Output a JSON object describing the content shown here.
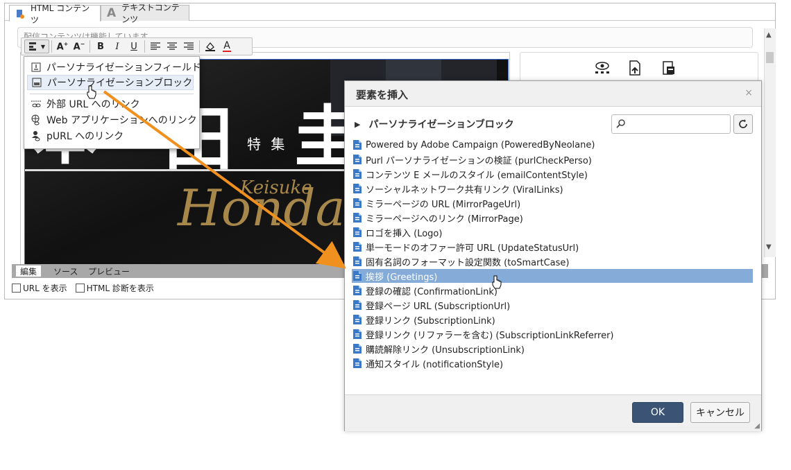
{
  "tabs": {
    "html": "HTML コンテンツ",
    "text": "テキストコンテンツ"
  },
  "editor": {
    "status_text": "配信コンテンツは機能しています",
    "bottom_tabs": [
      "編集",
      "ソース",
      "プレビュー"
    ],
    "checkboxes": [
      "URL を表示",
      "HTML 診断を表示"
    ]
  },
  "banner": {
    "kanji_left": "本",
    "kanji_mid": "田",
    "kanji_right": "圭",
    "tokushu": "特 集",
    "name_small": "Keisuke",
    "name_large": "Honda"
  },
  "menu": {
    "items": [
      {
        "label": "パーソナライゼーションフィールド",
        "icon": "field-icon"
      },
      {
        "label": "パーソナライゼーションブロック",
        "icon": "block-icon"
      },
      {
        "label": "外部 URL へのリンク",
        "icon": "link-icon"
      },
      {
        "label": "Web アプリケーションへのリンク",
        "icon": "web-link-icon"
      },
      {
        "label": "pURL へのリンク",
        "icon": "purl-icon"
      }
    ]
  },
  "dialog": {
    "title": "要素を挿入",
    "close": "×",
    "tree_label": "パーソナライゼーションブロック",
    "items": [
      "Powered by Adobe Campaign (PoweredByNeolane)",
      "Purl パーソナライゼーションの検証 (purlCheckPerso)",
      "コンテンツ E メールのスタイル (emailContentStyle)",
      "ソーシャルネットワーク共有リンク (ViralLinks)",
      "ミラーページの URL (MirrorPageUrl)",
      "ミラーページへのリンク (MirrorPage)",
      "ロゴを挿入 (Logo)",
      "単一モードのオファー許可 URL (UpdateStatusUrl)",
      "固有名詞のフォーマット設定関数 (toSmartCase)",
      "挨拶 (Greetings)",
      "登録の確認 (ConfirmationLink)",
      "登録ページ URL (SubscriptionUrl)",
      "登録リンク (SubscriptionLink)",
      "登録リンク (リファラーを含む) (SubscriptionLinkReferrer)",
      "購読解除リンク (UnsubscriptionLink)",
      "通知スタイル (notificationStyle)"
    ],
    "selected_index": 9,
    "ok": "OK",
    "cancel": "キャンセル"
  },
  "colors": {
    "selection": "#85acd8",
    "ok_button": "#3b5476",
    "arrow": "#f0901e",
    "gold_text": "#a8884a"
  }
}
